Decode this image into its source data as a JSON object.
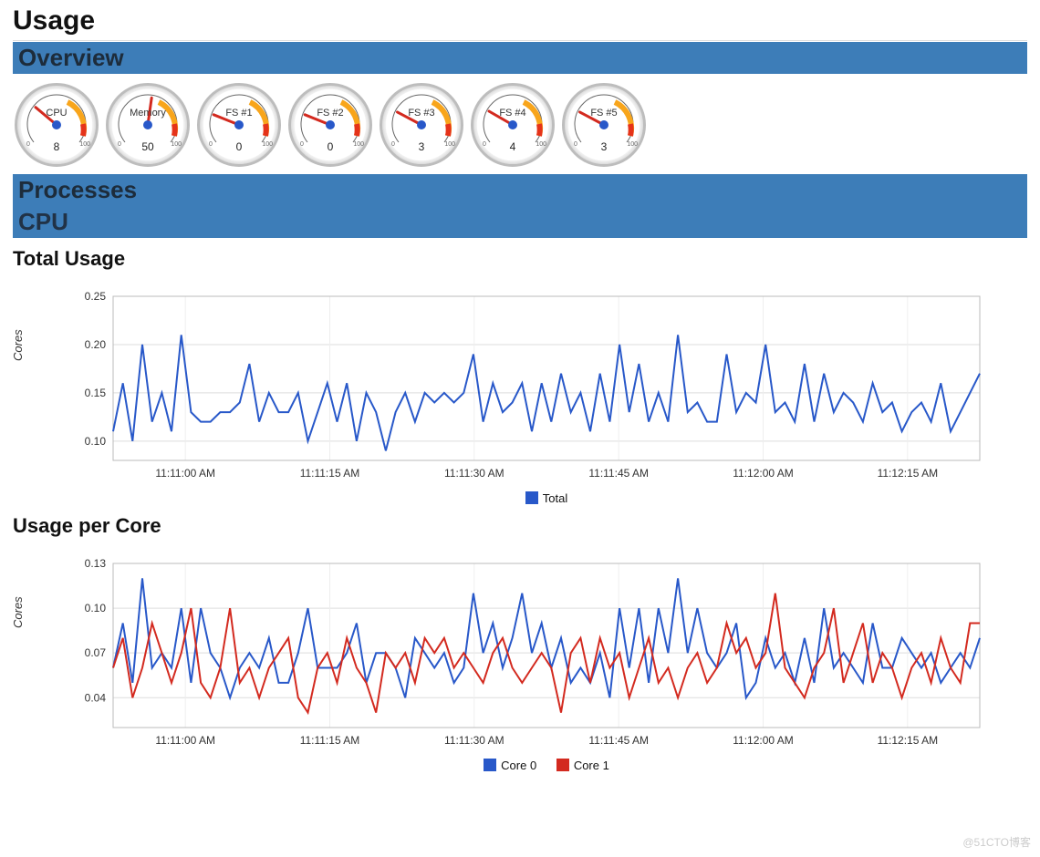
{
  "page_title": "Usage",
  "sections": {
    "overview": "Overview",
    "processes": "Processes",
    "cpu": "CPU"
  },
  "gauges": [
    {
      "label": "CPU",
      "value": "8",
      "min": "0",
      "max": "100",
      "angle": -50
    },
    {
      "label": "Memory",
      "value": "50",
      "min": "0",
      "max": "100",
      "angle": 8
    },
    {
      "label": "FS #1",
      "value": "0",
      "min": "0",
      "max": "100",
      "angle": -68
    },
    {
      "label": "FS #2",
      "value": "0",
      "min": "0",
      "max": "100",
      "angle": -68
    },
    {
      "label": "FS #3",
      "value": "3",
      "min": "0",
      "max": "100",
      "angle": -62
    },
    {
      "label": "FS #4",
      "value": "4",
      "min": "0",
      "max": "100",
      "angle": -60
    },
    {
      "label": "FS #5",
      "value": "3",
      "min": "0",
      "max": "100",
      "angle": -62
    }
  ],
  "total_usage": {
    "title": "Total Usage",
    "ylabel": "Cores",
    "legend": [
      "Total"
    ],
    "colors": [
      "#2858c9"
    ]
  },
  "per_core": {
    "title": "Usage per Core",
    "ylabel": "Cores",
    "legend": [
      "Core 0",
      "Core 1"
    ],
    "colors": [
      "#2858c9",
      "#d32a1f"
    ]
  },
  "watermark": "@51CTO博客",
  "chart_data": [
    {
      "type": "line",
      "title": "Total Usage",
      "ylabel": "Cores",
      "ylim": [
        0.08,
        0.25
      ],
      "yticks": [
        0.1,
        0.15,
        0.2,
        0.25
      ],
      "xticks": [
        "11:11:00 AM",
        "11:11:15 AM",
        "11:11:30 AM",
        "11:11:45 AM",
        "11:12:00 AM",
        "11:12:15 AM"
      ],
      "series": [
        {
          "name": "Total",
          "values": [
            0.11,
            0.16,
            0.1,
            0.2,
            0.12,
            0.15,
            0.11,
            0.21,
            0.13,
            0.12,
            0.12,
            0.13,
            0.13,
            0.14,
            0.18,
            0.12,
            0.15,
            0.13,
            0.13,
            0.15,
            0.1,
            0.13,
            0.16,
            0.12,
            0.16,
            0.1,
            0.15,
            0.13,
            0.09,
            0.13,
            0.15,
            0.12,
            0.15,
            0.14,
            0.15,
            0.14,
            0.15,
            0.19,
            0.12,
            0.16,
            0.13,
            0.14,
            0.16,
            0.11,
            0.16,
            0.12,
            0.17,
            0.13,
            0.15,
            0.11,
            0.17,
            0.12,
            0.2,
            0.13,
            0.18,
            0.12,
            0.15,
            0.12,
            0.21,
            0.13,
            0.14,
            0.12,
            0.12,
            0.19,
            0.13,
            0.15,
            0.14,
            0.2,
            0.13,
            0.14,
            0.12,
            0.18,
            0.12,
            0.17,
            0.13,
            0.15,
            0.14,
            0.12,
            0.16,
            0.13,
            0.14,
            0.11,
            0.13,
            0.14,
            0.12,
            0.16,
            0.11,
            0.13,
            0.15,
            0.17
          ]
        }
      ]
    },
    {
      "type": "line",
      "title": "Usage per Core",
      "ylabel": "Cores",
      "ylim": [
        0.02,
        0.13
      ],
      "yticks": [
        0.04,
        0.07,
        0.1,
        0.13
      ],
      "xticks": [
        "11:11:00 AM",
        "11:11:15 AM",
        "11:11:30 AM",
        "11:11:45 AM",
        "11:12:00 AM",
        "11:12:15 AM"
      ],
      "series": [
        {
          "name": "Core 0",
          "values": [
            0.06,
            0.09,
            0.05,
            0.12,
            0.06,
            0.07,
            0.06,
            0.1,
            0.05,
            0.1,
            0.07,
            0.06,
            0.04,
            0.06,
            0.07,
            0.06,
            0.08,
            0.05,
            0.05,
            0.07,
            0.1,
            0.06,
            0.06,
            0.06,
            0.07,
            0.09,
            0.05,
            0.07,
            0.07,
            0.06,
            0.04,
            0.08,
            0.07,
            0.06,
            0.07,
            0.05,
            0.06,
            0.11,
            0.07,
            0.09,
            0.06,
            0.08,
            0.11,
            0.07,
            0.09,
            0.06,
            0.08,
            0.05,
            0.06,
            0.05,
            0.07,
            0.04,
            0.1,
            0.06,
            0.1,
            0.05,
            0.1,
            0.07,
            0.12,
            0.07,
            0.1,
            0.07,
            0.06,
            0.07,
            0.09,
            0.04,
            0.05,
            0.08,
            0.06,
            0.07,
            0.05,
            0.08,
            0.05,
            0.1,
            0.06,
            0.07,
            0.06,
            0.05,
            0.09,
            0.06,
            0.06,
            0.08,
            0.07,
            0.06,
            0.07,
            0.05,
            0.06,
            0.07,
            0.06,
            0.08
          ]
        },
        {
          "name": "Core 1",
          "values": [
            0.06,
            0.08,
            0.04,
            0.06,
            0.09,
            0.07,
            0.05,
            0.07,
            0.1,
            0.05,
            0.04,
            0.06,
            0.1,
            0.05,
            0.06,
            0.04,
            0.06,
            0.07,
            0.08,
            0.04,
            0.03,
            0.06,
            0.07,
            0.05,
            0.08,
            0.06,
            0.05,
            0.03,
            0.07,
            0.06,
            0.07,
            0.05,
            0.08,
            0.07,
            0.08,
            0.06,
            0.07,
            0.06,
            0.05,
            0.07,
            0.08,
            0.06,
            0.05,
            0.06,
            0.07,
            0.06,
            0.03,
            0.07,
            0.08,
            0.05,
            0.08,
            0.06,
            0.07,
            0.04,
            0.06,
            0.08,
            0.05,
            0.06,
            0.04,
            0.06,
            0.07,
            0.05,
            0.06,
            0.09,
            0.07,
            0.08,
            0.06,
            0.07,
            0.11,
            0.06,
            0.05,
            0.04,
            0.06,
            0.07,
            0.1,
            0.05,
            0.07,
            0.09,
            0.05,
            0.07,
            0.06,
            0.04,
            0.06,
            0.07,
            0.05,
            0.08,
            0.06,
            0.05,
            0.09,
            0.09
          ]
        }
      ]
    }
  ]
}
